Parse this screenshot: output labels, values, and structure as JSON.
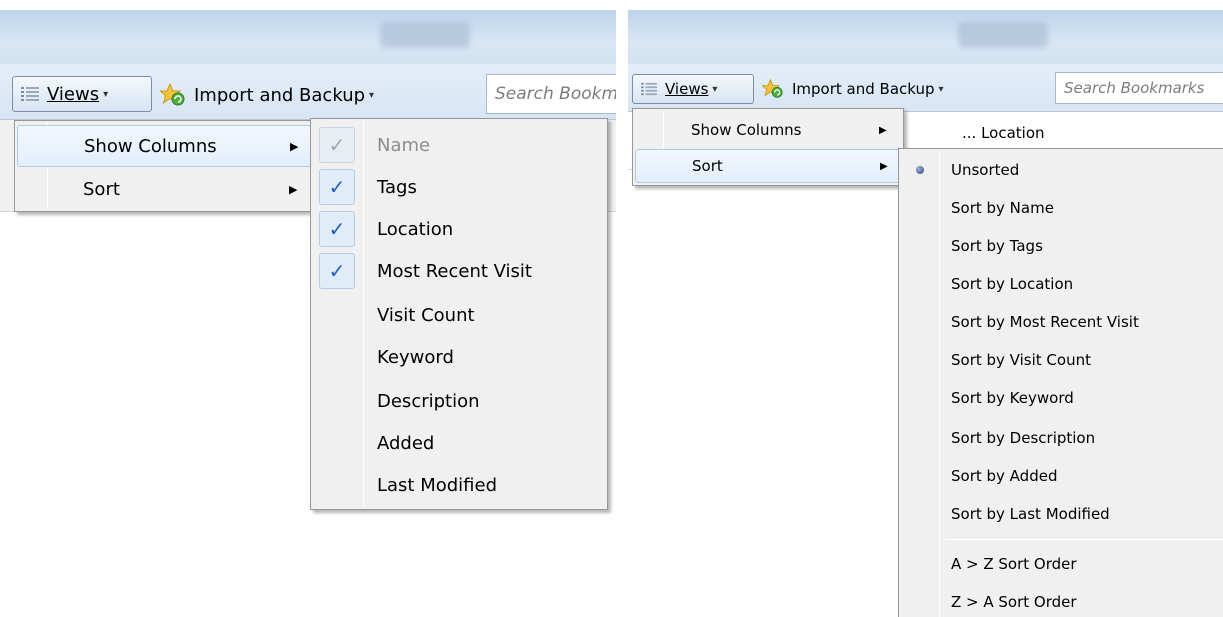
{
  "left": {
    "toolbar": {
      "views_label": "Views",
      "import_label": "Import and Backup",
      "search_placeholder": "Search Bookmarks"
    },
    "views_menu": [
      {
        "label": "Show Columns",
        "highlighted": true,
        "submenu": true
      },
      {
        "label": "Sort",
        "highlighted": false,
        "submenu": true
      }
    ],
    "columns_menu": [
      {
        "label": "Name",
        "checked": true,
        "disabled": true
      },
      {
        "label": "Tags",
        "checked": true
      },
      {
        "label": "Location",
        "checked": true
      },
      {
        "label": "Most Recent Visit",
        "checked": true
      },
      {
        "label": "Visit Count",
        "checked": false
      },
      {
        "label": "Keyword",
        "checked": false
      },
      {
        "label": "Description",
        "checked": false
      },
      {
        "label": "Added",
        "checked": false
      },
      {
        "label": "Last Modified",
        "checked": false
      }
    ]
  },
  "right": {
    "toolbar": {
      "views_label": "Views",
      "import_label": "Import and Backup",
      "search_placeholder": "Search Bookmarks"
    },
    "column_header": "... Location",
    "views_menu": [
      {
        "label": "Show Columns",
        "highlighted": false,
        "submenu": true
      },
      {
        "label": "Sort",
        "highlighted": true,
        "submenu": true
      }
    ],
    "sort_menu": [
      {
        "label": "Unsorted",
        "selected": true
      },
      {
        "label": "Sort by Name"
      },
      {
        "label": "Sort by Tags"
      },
      {
        "label": "Sort by Location"
      },
      {
        "label": "Sort by Most Recent Visit"
      },
      {
        "label": "Sort by Visit Count"
      },
      {
        "label": "Sort by Keyword"
      },
      {
        "label": "Sort by Description"
      },
      {
        "label": "Sort by Added"
      },
      {
        "label": "Sort by Last Modified"
      },
      {
        "label": "A > Z Sort Order"
      },
      {
        "label": "Z > A Sort Order"
      }
    ]
  },
  "icons": {
    "views": "list-icon",
    "import": "star-refresh-icon",
    "submenu": "submenu-arrow-icon",
    "check": "checkmark-icon",
    "radio": "radio-bullet-icon"
  },
  "colors": {
    "highlight_border": "#aecbee",
    "check_color": "#1f5fbf",
    "menu_bg": "#f0f0f0"
  }
}
